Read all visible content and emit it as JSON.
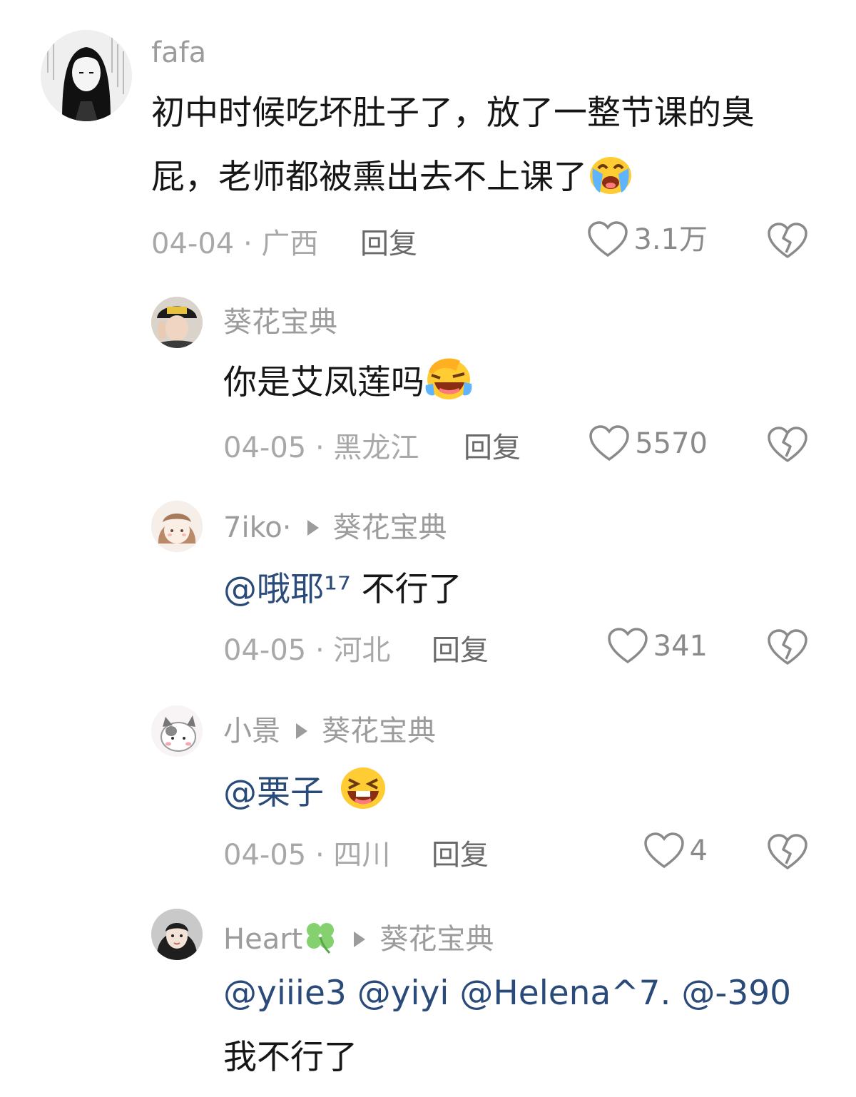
{
  "comments": [
    {
      "user": "fafa",
      "text": [
        "初中时候吃坏肚子了，放了一整节课的臭",
        "屁，老师都被熏出去不上课了"
      ],
      "date_location": "04-04 · 广西",
      "reply_label": "回复",
      "likes": "3.1万"
    },
    {
      "user": "葵花宝典",
      "text": "你是艾凤莲吗",
      "date_location": "04-05 · 黑龙江",
      "reply_label": "回复",
      "likes": "5570"
    },
    {
      "user": "7iko·",
      "reply_to": "葵花宝典",
      "mention": "@哦耶¹⁷",
      "text": " 不行了",
      "date_location": "04-05 · 河北",
      "reply_label": "回复",
      "likes": "341"
    },
    {
      "user": "小景",
      "reply_to": "葵花宝典",
      "mention": "@栗子",
      "text": "",
      "date_location": "04-05 · 四川",
      "reply_label": "回复",
      "likes": "4"
    },
    {
      "user": "Heart",
      "reply_to": "葵花宝典",
      "mention": "@yiiie3 @yiyi @Helena^7. @-390",
      "text": "我不行了"
    }
  ],
  "icons": {
    "like": "heart-outline-icon",
    "dislike": "broken-heart-icon",
    "emoji_1": "loudly-crying-face-emoji",
    "emoji_2": "laughing-face-emoji",
    "emoji_3": "grinning-squinting-face-emoji",
    "clover": "four-leaf-clover-emoji"
  },
  "colors": {
    "background": "#ffffff",
    "text": "#161616",
    "meta": "#a8a8a8",
    "mention": "#2a4a7a"
  }
}
